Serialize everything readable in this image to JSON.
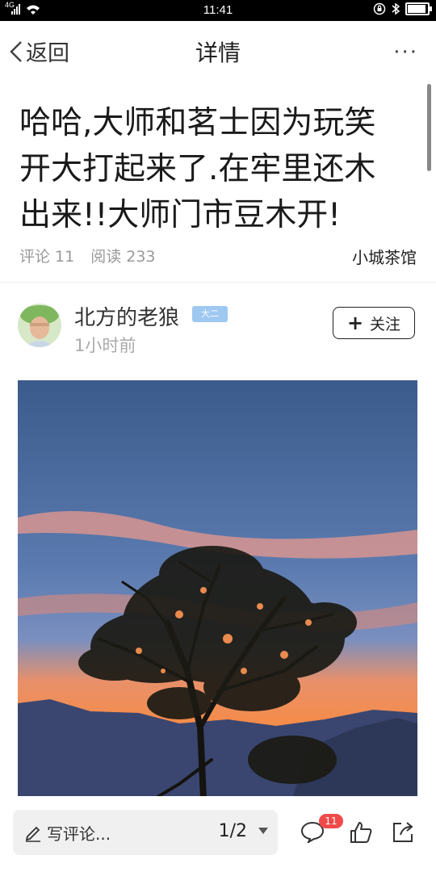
{
  "status_bar": {
    "signal": "4G",
    "time": "11:41"
  },
  "nav": {
    "back_label": "返回",
    "title": "详情",
    "more_label": "···"
  },
  "article": {
    "title": "哈哈,大师和茗士因为玩笑开大打起来了.在牢里还木出来!!大师门市豆木开!",
    "comments_text": "评论 11",
    "reads_text": "阅读 233",
    "source": "小城茶馆"
  },
  "author": {
    "name": "北方的老狼",
    "badge": "大二",
    "time": "1小时前",
    "follow_label": "关注"
  },
  "bottom_bar": {
    "comment_placeholder": "写评论...",
    "pager": "1/2",
    "comment_count": "11"
  },
  "icons": {
    "back": "chevron-left-icon",
    "more": "more-icon",
    "plus": "plus-icon",
    "pencil": "pencil-icon",
    "comment": "comment-icon",
    "like": "thumbs-up-icon",
    "share": "share-icon"
  },
  "colors": {
    "badge": "#9ec8f0",
    "count_badge": "#f04a4a",
    "sky_top": "#3f5f8e",
    "sunset": "#f08a4a"
  }
}
